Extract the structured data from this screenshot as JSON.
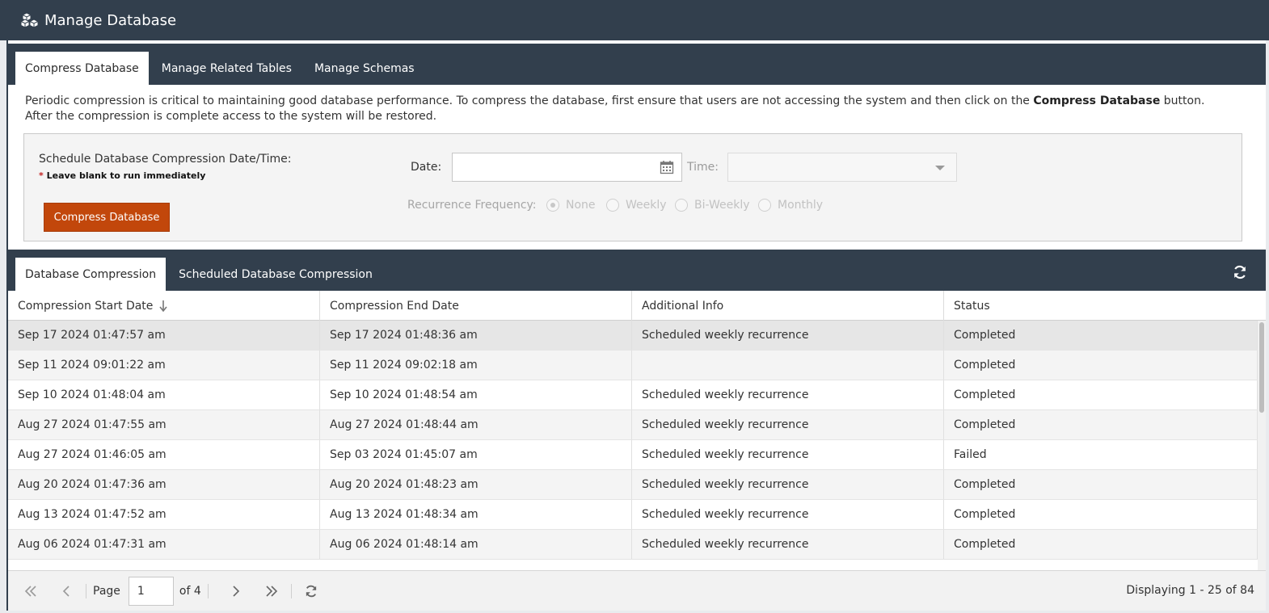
{
  "window": {
    "title": "Manage Database",
    "icon": "database-cubes-icon"
  },
  "top_tabs": [
    {
      "label": "Compress Database",
      "active": true
    },
    {
      "label": "Manage Related Tables",
      "active": false
    },
    {
      "label": "Manage Schemas",
      "active": false
    }
  ],
  "intro": {
    "text_before": "Periodic compression is critical to maintaining good database performance. To compress the database, first ensure that users are not accessing the system and then click on the ",
    "bold": "Compress Database",
    "text_after": " button. After the compression is complete access to the system will be restored."
  },
  "schedule": {
    "label": "Schedule Database Compression Date/Time:",
    "note_star": "*",
    "note": " Leave blank to run immediately",
    "button_label": "Compress Database",
    "date_label": "Date:",
    "date_value": "",
    "time_label": "Time:",
    "time_value": "",
    "recurrence_label": "Recurrence Frequency:",
    "recurrence_options": [
      {
        "label": "None",
        "selected": true
      },
      {
        "label": "Weekly",
        "selected": false
      },
      {
        "label": "Bi-Weekly",
        "selected": false
      },
      {
        "label": "Monthly",
        "selected": false
      }
    ]
  },
  "bottom_tabs": [
    {
      "label": "Database Compression",
      "active": true
    },
    {
      "label": "Scheduled Database Compression",
      "active": false
    }
  ],
  "grid": {
    "columns": [
      "Compression Start Date",
      "Compression End Date",
      "Additional Info",
      "Status"
    ],
    "sorted_column": "Compression Start Date",
    "sort_direction": "descending",
    "rows": [
      [
        "Sep 17 2024 01:47:57 am",
        "Sep 17 2024 01:48:36 am",
        "Scheduled weekly recurrence",
        "Completed"
      ],
      [
        "Sep 11 2024 09:01:22 am",
        "Sep 11 2024 09:02:18 am",
        "",
        "Completed"
      ],
      [
        "Sep 10 2024 01:48:04 am",
        "Sep 10 2024 01:48:54 am",
        "Scheduled weekly recurrence",
        "Completed"
      ],
      [
        "Aug 27 2024 01:47:55 am",
        "Aug 27 2024 01:48:44 am",
        "Scheduled weekly recurrence",
        "Completed"
      ],
      [
        "Aug 27 2024 01:46:05 am",
        "Sep 03 2024 01:45:07 am",
        "Scheduled weekly recurrence",
        "Failed"
      ],
      [
        "Aug 20 2024 01:47:36 am",
        "Aug 20 2024 01:48:23 am",
        "Scheduled weekly recurrence",
        "Completed"
      ],
      [
        "Aug 13 2024 01:47:52 am",
        "Aug 13 2024 01:48:34 am",
        "Scheduled weekly recurrence",
        "Completed"
      ],
      [
        "Aug 06 2024 01:47:31 am",
        "Aug 06 2024 01:48:14 am",
        "Scheduled weekly recurrence",
        "Completed"
      ]
    ]
  },
  "pager": {
    "page_label": "Page",
    "page_value": "1",
    "of_label": "of 4",
    "display_info": "Displaying 1 - 25 of 84"
  }
}
